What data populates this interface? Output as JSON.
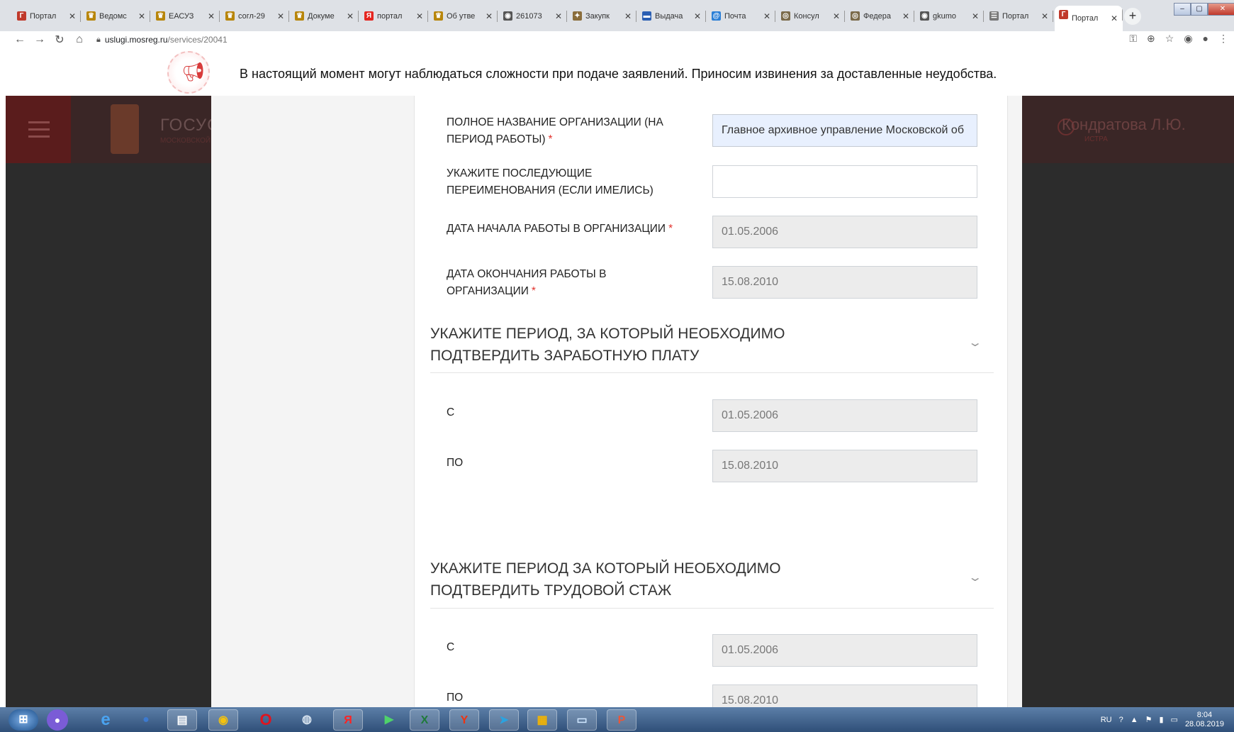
{
  "browser": {
    "tabs": [
      {
        "title": "Портал",
        "fav_color": "#c0392b",
        "fav_glyph": "Г"
      },
      {
        "title": "Ведомс",
        "fav_color": "#b8860b",
        "fav_glyph": "♛"
      },
      {
        "title": "ЕАСУЗ",
        "fav_color": "#b8860b",
        "fav_glyph": "♛"
      },
      {
        "title": "согл-29",
        "fav_color": "#b8860b",
        "fav_glyph": "♛"
      },
      {
        "title": "Докуме",
        "fav_color": "#b8860b",
        "fav_glyph": "♛"
      },
      {
        "title": "портал",
        "fav_color": "#e52620",
        "fav_glyph": "Я"
      },
      {
        "title": "Об утве",
        "fav_color": "#b8860b",
        "fav_glyph": "♛"
      },
      {
        "title": "261073",
        "fav_color": "#555555",
        "fav_glyph": "◉"
      },
      {
        "title": "Закупк",
        "fav_color": "#8a6d3b",
        "fav_glyph": "✦"
      },
      {
        "title": "Выдача",
        "fav_color": "#2b5fb3",
        "fav_glyph": "▬"
      },
      {
        "title": "Почта",
        "fav_color": "#2b7fd6",
        "fav_glyph": "@"
      },
      {
        "title": "Консул",
        "fav_color": "#7a6a4a",
        "fav_glyph": "◎"
      },
      {
        "title": "Федера",
        "fav_color": "#7a6a4a",
        "fav_glyph": "◎"
      },
      {
        "title": "gkumo",
        "fav_color": "#555555",
        "fav_glyph": "◉"
      },
      {
        "title": "Портал",
        "fav_color": "#777777",
        "fav_glyph": "☰"
      },
      {
        "title": "Портал",
        "fav_color": "#c0392b",
        "fav_glyph": "Г"
      }
    ],
    "new_tab": "+",
    "url_host": "uslugi.mosreg.ru",
    "url_path": "/services/20041"
  },
  "notice": {
    "text": "В настоящий момент могут наблюдаться сложности при подаче заявлений. Приносим извинения за доставленные неудобства."
  },
  "header": {
    "brand": "ГОСУСЛ",
    "brand_sub": "МОСКОВСКОЙ",
    "user_name": "Кондратова Л.Ю.",
    "user_location": "ИСТРА"
  },
  "form": {
    "org_name_label": "ПОЛНОЕ НАЗВАНИЕ ОРГАНИЗАЦИИ (НА ПЕРИОД РАБОТЫ)",
    "org_name_value": "Главное архивное управление Московской об",
    "renames_label": "УКАЖИТЕ ПОСЛЕДУЮЩИЕ ПЕРЕИМЕНОВАНИЯ (ЕСЛИ ИМЕЛИСЬ)",
    "renames_value": "",
    "start_label": "ДАТА НАЧАЛА РАБОТЫ В ОРГАНИЗАЦИИ",
    "start_value": "01.05.2006",
    "end_label": "ДАТА ОКОНЧАНИЯ РАБОТЫ В ОРГАНИЗАЦИИ",
    "end_value": "15.08.2010",
    "required_mark": "*",
    "salary_section": {
      "title": "УКАЖИТЕ ПЕРИОД, ЗА КОТОРЫЙ НЕОБХОДИМО ПОДТВЕРДИТЬ ЗАРАБОТНУЮ ПЛАТУ",
      "from_label": "С",
      "from_value": "01.05.2006",
      "to_label": "ПО",
      "to_value": "15.08.2010"
    },
    "experience_section": {
      "title": "УКАЖИТЕ ПЕРИОД ЗА КОТОРЫЙ НЕОБХОДИМО ПОДТВЕРДИТЬ ТРУДОВОЙ СТАЖ",
      "from_label": "С",
      "from_value": "01.05.2006",
      "to_label": "ПО",
      "to_value": "15.08.2010"
    }
  },
  "taskbar": {
    "lang": "RU",
    "time": "8:04",
    "date": "28.08.2019"
  },
  "colors": {
    "required": "#e2342f",
    "autofill_bg": "#e8f0fe",
    "readonly_bg": "#ececec"
  }
}
